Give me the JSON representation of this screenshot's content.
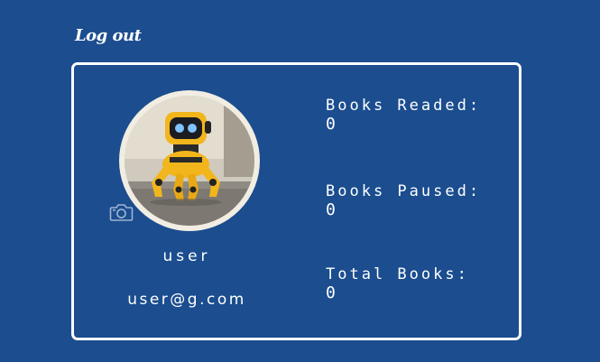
{
  "header": {
    "logout_label": "Log out"
  },
  "profile": {
    "avatar_alt": "yellow robot",
    "username": "user",
    "email": "user@g.com"
  },
  "stats": {
    "books_readed_label": "Books Readed:",
    "books_readed_value": "0",
    "books_paused_label": "Books Paused:",
    "books_paused_value": "0",
    "total_books_label": "Total Books:",
    "total_books_value": "0"
  },
  "colors": {
    "background": "#1b4d8f",
    "card_border": "#ffffff",
    "avatar_ring": "#f1ede2",
    "robot_body": "#f2b51c"
  },
  "icons": {
    "upload": "camera-icon"
  }
}
